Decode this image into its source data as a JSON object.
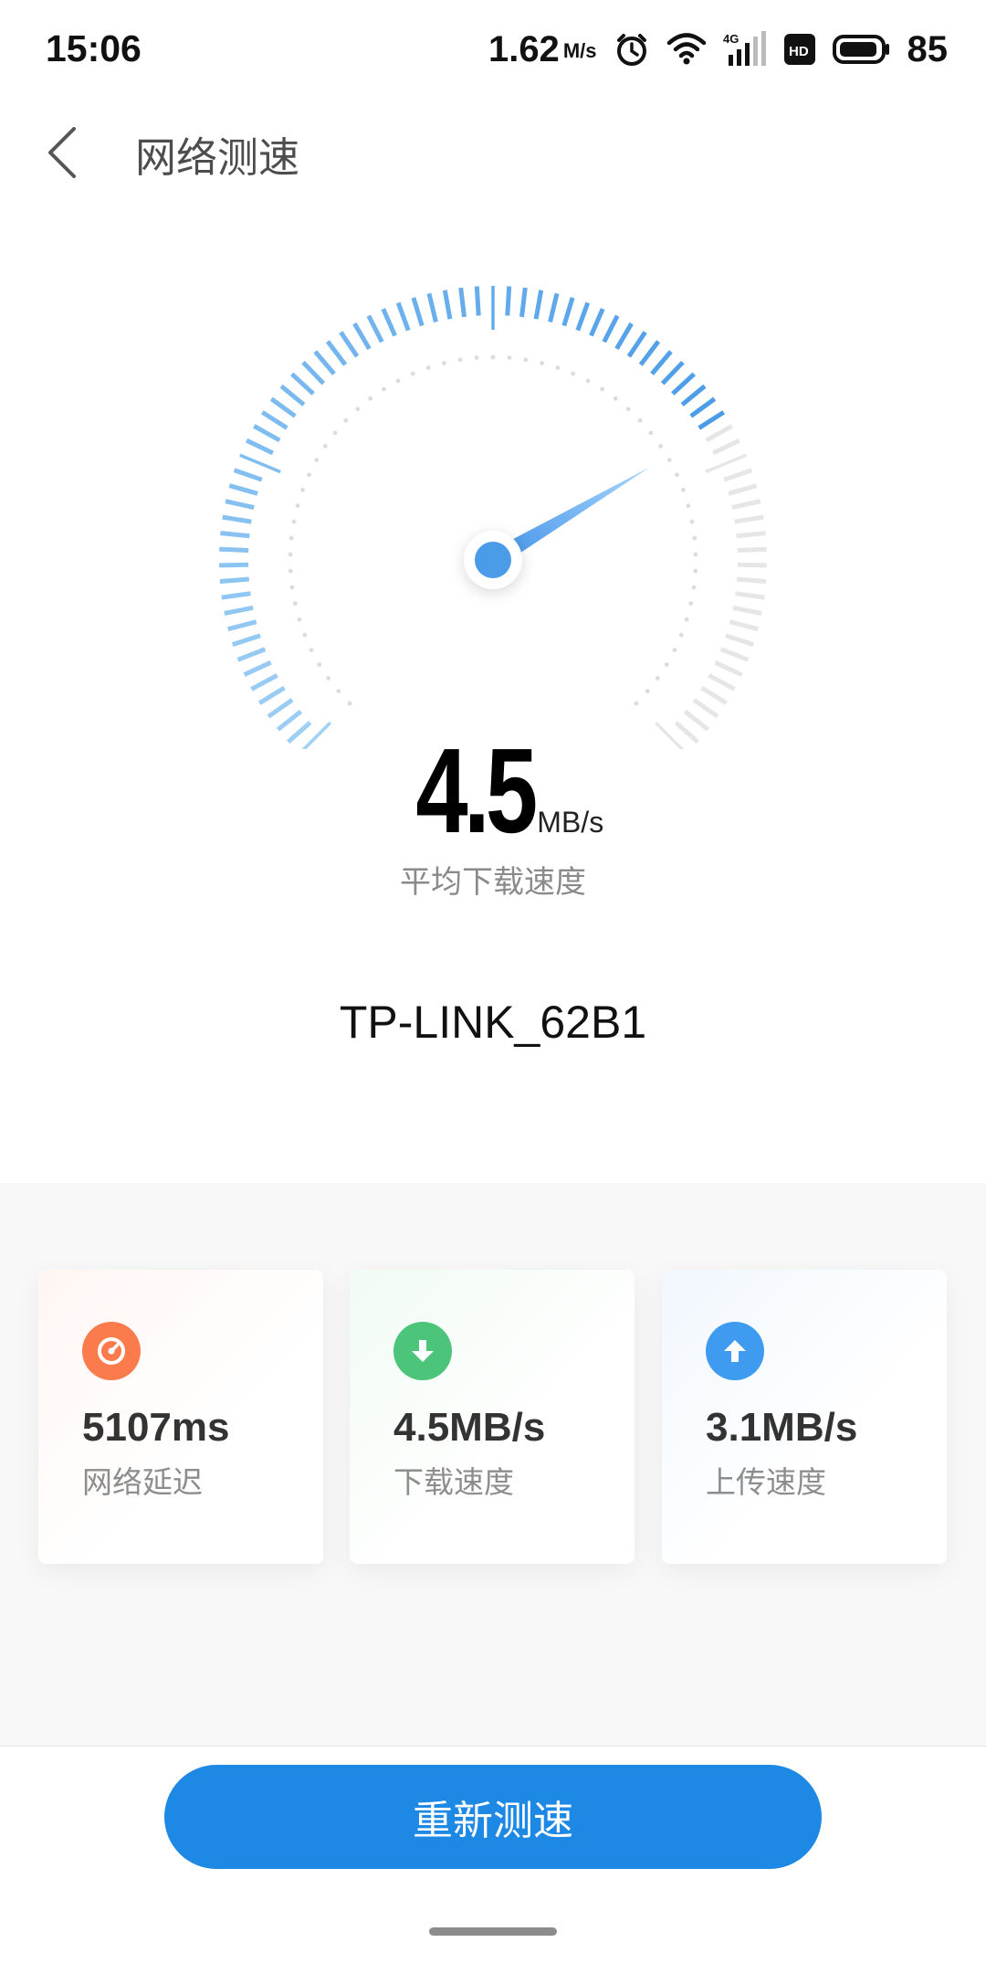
{
  "status_bar": {
    "time": "15:06",
    "net_speed": "1.62",
    "net_speed_unit": "M/s",
    "battery_level": "85",
    "icons": [
      "alarm-icon",
      "wifi-icon",
      "cellular-4g-icon",
      "hd-icon",
      "battery-icon"
    ]
  },
  "header": {
    "title": "网络测速",
    "back_icon": "chevron-left-icon"
  },
  "speed_test": {
    "value": "4.5",
    "unit": "MB/s",
    "caption": "平均下载速度",
    "gauge_fraction": 0.72,
    "network_name": "TP-LINK_62B1"
  },
  "stats": [
    {
      "value": "5107ms",
      "label": "网络延迟",
      "icon": "gauge-icon",
      "color": "#fb7b4c"
    },
    {
      "value": "4.5MB/s",
      "label": "下载速度",
      "icon": "download-arrow-icon",
      "color": "#4cc57b"
    },
    {
      "value": "3.1MB/s",
      "label": "上传速度",
      "icon": "upload-arrow-icon",
      "color": "#3e9bf0"
    }
  ],
  "actions": {
    "retest_label": "重新测速"
  },
  "colors": {
    "accent": "#1e88e5",
    "gauge_blue": "#4a9be8",
    "gauge_light": "#9fd0f5",
    "gauge_inactive": "#e6e6e6"
  }
}
